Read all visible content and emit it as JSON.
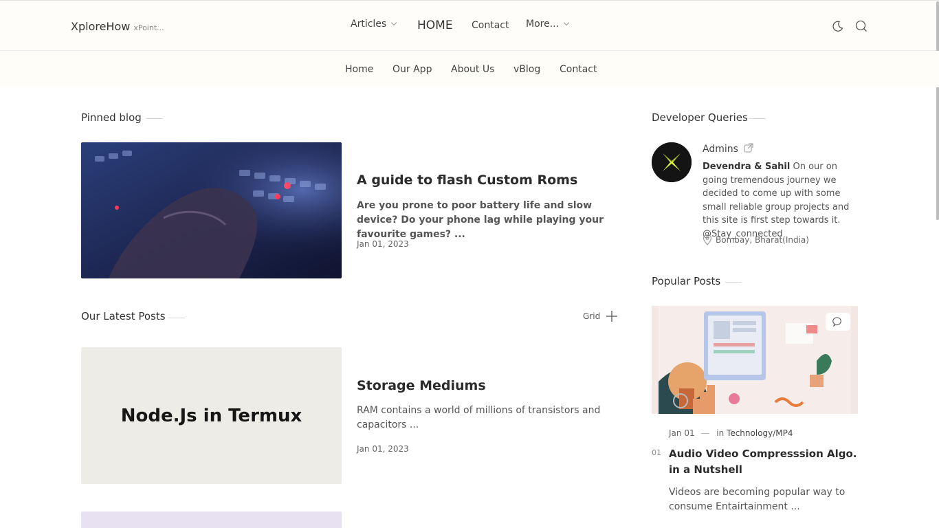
{
  "header": {
    "brand": "XploreHow",
    "brand_tag": "xPoint...",
    "nav": {
      "articles": "Articles",
      "home": "HOME",
      "contact": "Contact",
      "more": "More..."
    },
    "icons": [
      "moon-icon",
      "search-icon"
    ]
  },
  "subnav": {
    "items": [
      "Home",
      "Our App",
      "About Us",
      "vBlog",
      "Contact"
    ]
  },
  "pinned": {
    "section_title": "Pinned blog",
    "post": {
      "title": "A guide to flash Custom Roms",
      "excerpt": "Are you prone to poor battery life and slow device? Do your phone lag while playing your favourite games? ...",
      "date": "Jan 01, 2023"
    }
  },
  "latest": {
    "section_title": "Our Latest Posts",
    "view_toggle": "Grid",
    "posts": [
      {
        "thumb_text": "Node.Js in Termux",
        "title": "Storage Mediums",
        "excerpt": "RAM contains a world of millions of transistors and capacitors ...",
        "date": "Jan 01, 2023"
      }
    ]
  },
  "sidebar": {
    "queries": {
      "section_title": "Developer Queries",
      "admins_label": "Admins",
      "authors": "Devendra & Sahil",
      "bio": " On our on going tremendous journey we decided to come up with some small reliable group projects and this site is first step towards it. @Stay_connected",
      "location": "Bombay, Bharat(India)"
    },
    "popular": {
      "section_title": "Popular Posts",
      "posts": [
        {
          "number": "01",
          "date": "Jan 01",
          "in_label": "in",
          "category": "Technology/MP4",
          "title": "Audio Video Compresssion Algo. in a Nutshell",
          "excerpt": "Videos are becoming popular way to consume Entairtainment ..."
        }
      ]
    }
  },
  "colors": {
    "header_bg": "#fffdfa",
    "subnav_bg": "#fffdf8",
    "thumb_placeholder": "#edece6",
    "accent_logo": "#d8f03a"
  }
}
